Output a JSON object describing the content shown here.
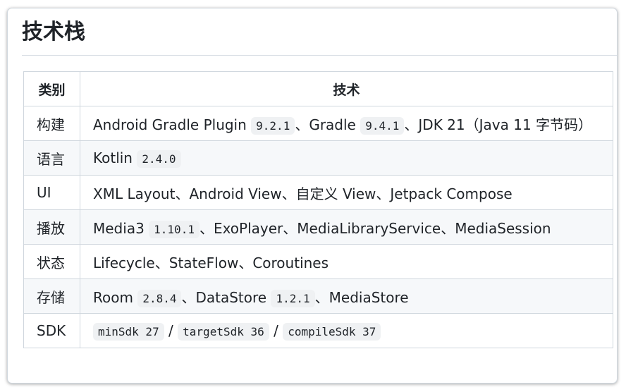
{
  "title": "技术栈",
  "table": {
    "headers": [
      "类别",
      "技术"
    ],
    "rows": [
      {
        "category": "构建",
        "parts": [
          {
            "t": "Android Gradle Plugin "
          },
          {
            "c": "9.2.1"
          },
          {
            "t": "、Gradle "
          },
          {
            "c": "9.4.1"
          },
          {
            "t": "、JDK 21（Java 11 字节码）"
          }
        ]
      },
      {
        "category": "语言",
        "parts": [
          {
            "t": "Kotlin "
          },
          {
            "c": "2.4.0"
          }
        ]
      },
      {
        "category": "UI",
        "parts": [
          {
            "t": "XML Layout、Android View、自定义 View、Jetpack Compose"
          }
        ]
      },
      {
        "category": "播放",
        "parts": [
          {
            "t": "Media3 "
          },
          {
            "c": "1.10.1"
          },
          {
            "t": "、ExoPlayer、MediaLibraryService、MediaSession"
          }
        ]
      },
      {
        "category": "状态",
        "parts": [
          {
            "t": "Lifecycle、StateFlow、Coroutines"
          }
        ]
      },
      {
        "category": "存储",
        "parts": [
          {
            "t": "Room "
          },
          {
            "c": "2.8.4"
          },
          {
            "t": "、DataStore "
          },
          {
            "c": "1.2.1"
          },
          {
            "t": "、MediaStore"
          }
        ]
      },
      {
        "category": "SDK",
        "parts": [
          {
            "c": "minSdk 27"
          },
          {
            "t": " / "
          },
          {
            "c": "targetSdk 36"
          },
          {
            "t": " / "
          },
          {
            "c": "compileSdk 37"
          }
        ]
      }
    ]
  }
}
